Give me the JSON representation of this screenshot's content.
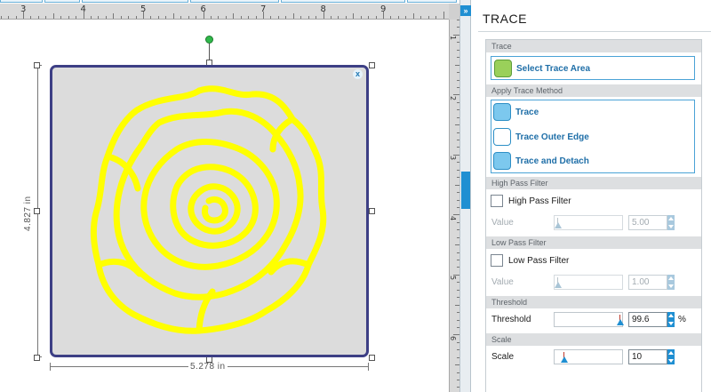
{
  "ruler": {
    "h_numbers": [
      "3",
      "4",
      "5",
      "6",
      "7",
      "8",
      "9"
    ],
    "v_numbers": [
      "1",
      "2",
      "3",
      "4",
      "5",
      "6"
    ]
  },
  "canvas": {
    "height_label": "4.827 in",
    "width_label": "5.278 in",
    "close_glyph": "x",
    "rose_color": "#ffff00",
    "frame_color": "#3d3f85"
  },
  "panel": {
    "collapse_glyph": "»",
    "title": "TRACE",
    "accent_color": "#1f8fd2",
    "sections": {
      "trace": {
        "header": "Trace",
        "select_area_label": "Select Trace Area"
      },
      "method": {
        "header": "Apply Trace Method",
        "options": [
          "Trace",
          "Trace Outer Edge",
          "Trace and Detach"
        ]
      },
      "high_pass": {
        "header": "High Pass Filter",
        "checkbox_label": "High Pass Filter",
        "checked": false,
        "value_label": "Value",
        "value": "5.00"
      },
      "low_pass": {
        "header": "Low Pass Filter",
        "checkbox_label": "Low Pass Filter",
        "checked": false,
        "value_label": "Value",
        "value": "1.00"
      },
      "threshold": {
        "header": "Threshold",
        "label": "Threshold",
        "value": "99.6",
        "unit": "%"
      },
      "scale": {
        "header": "Scale",
        "label": "Scale",
        "value": "10"
      }
    }
  }
}
